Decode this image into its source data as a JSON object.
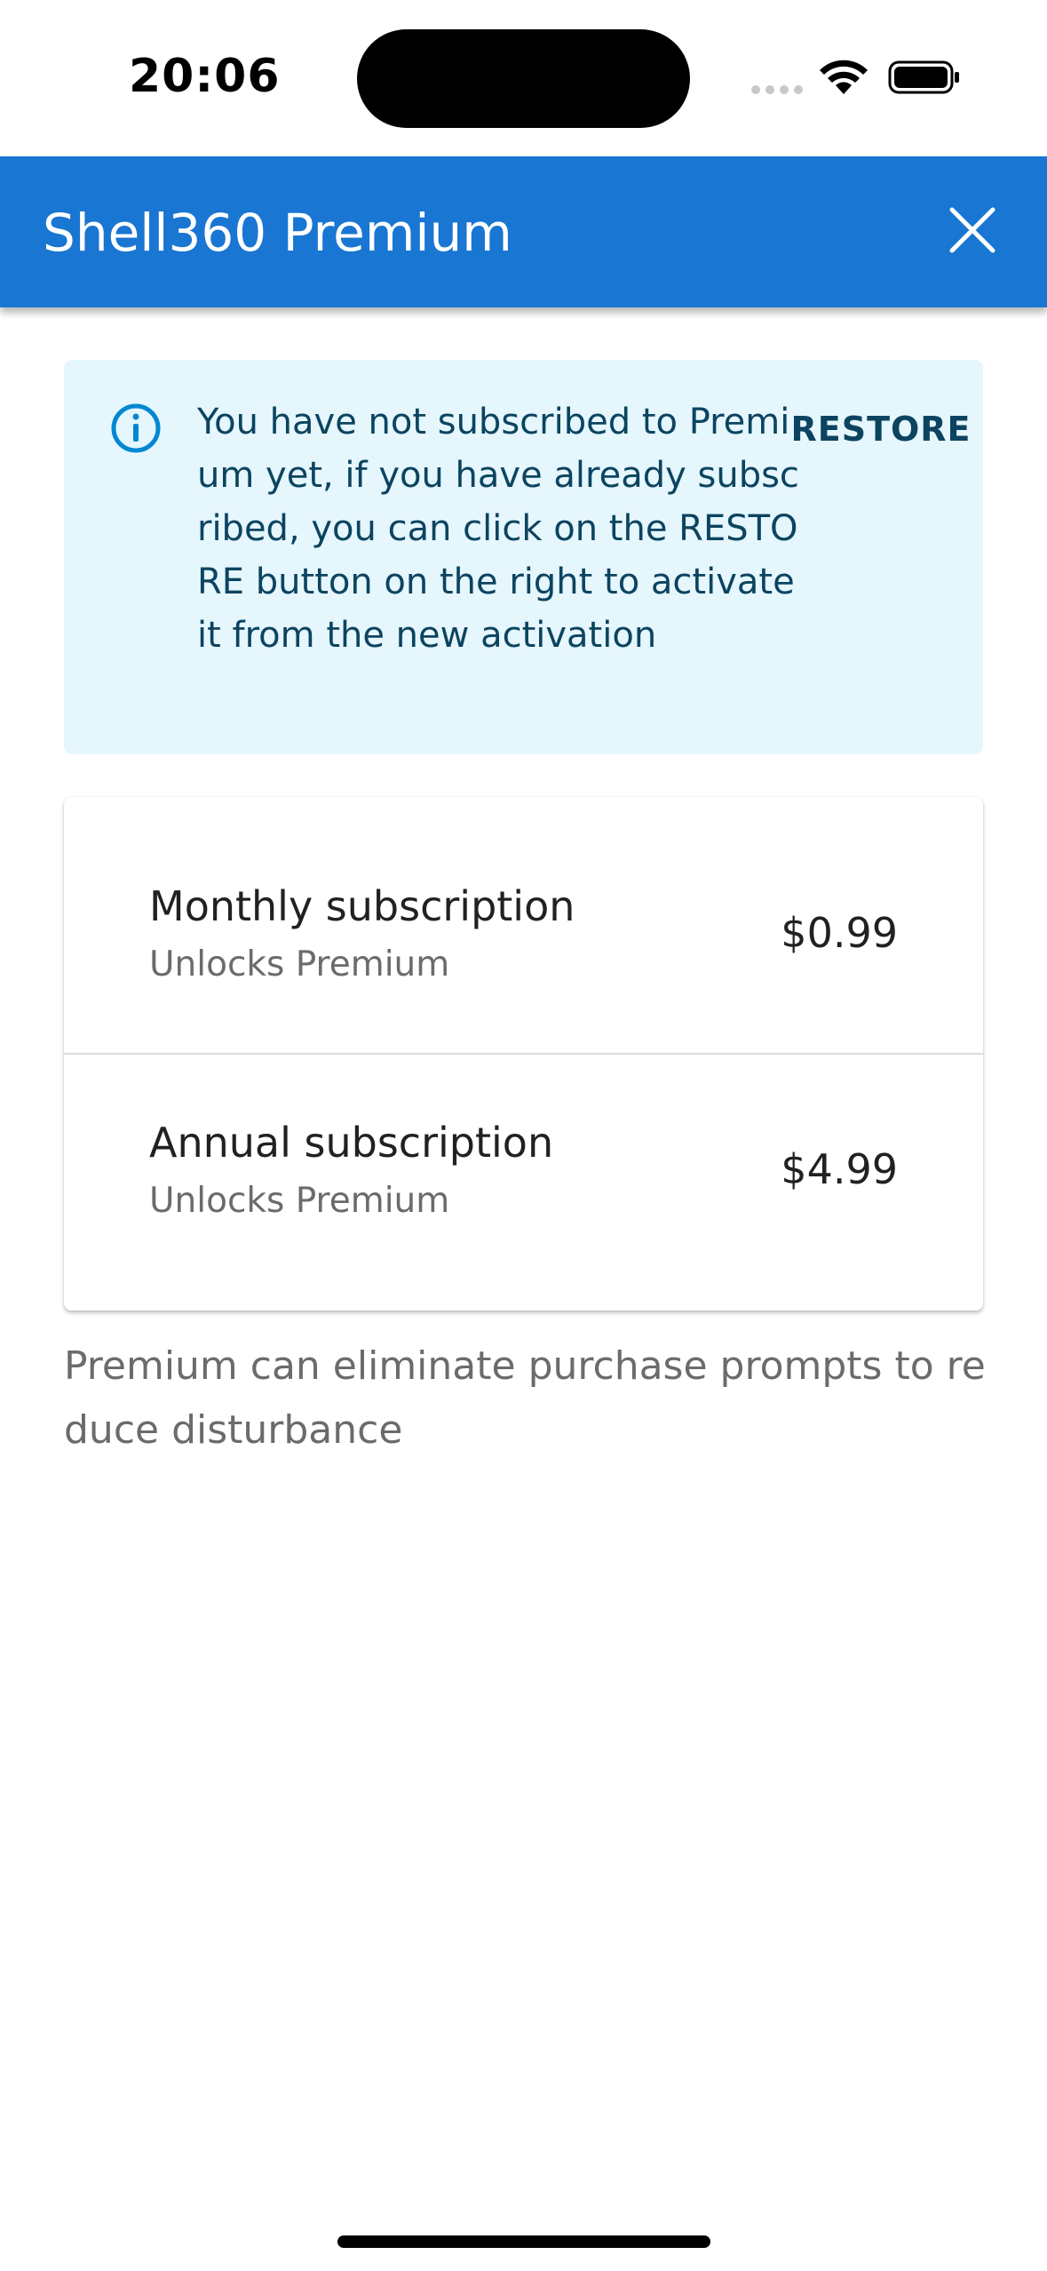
{
  "status_bar": {
    "time": "20:06"
  },
  "app_bar": {
    "title": "Shell360 Premium",
    "close_icon": "close-icon",
    "color": "#1976d2"
  },
  "info_banner": {
    "message": "You have not subscribed to Premium yet, if you have already subscribed, you can click on the RESTORE button on the right to activate it from the new activation",
    "restore_label": "RESTORE",
    "icon": "info-icon",
    "background": "#e5f6fd"
  },
  "plans": [
    {
      "name": "Monthly subscription",
      "subtitle": "Unlocks Premium",
      "price": "$0.99"
    },
    {
      "name": "Annual subscription",
      "subtitle": "Unlocks Premium",
      "price": "$4.99"
    }
  ],
  "footnote": "Premium can eliminate purchase prompts to reduce disturbance"
}
